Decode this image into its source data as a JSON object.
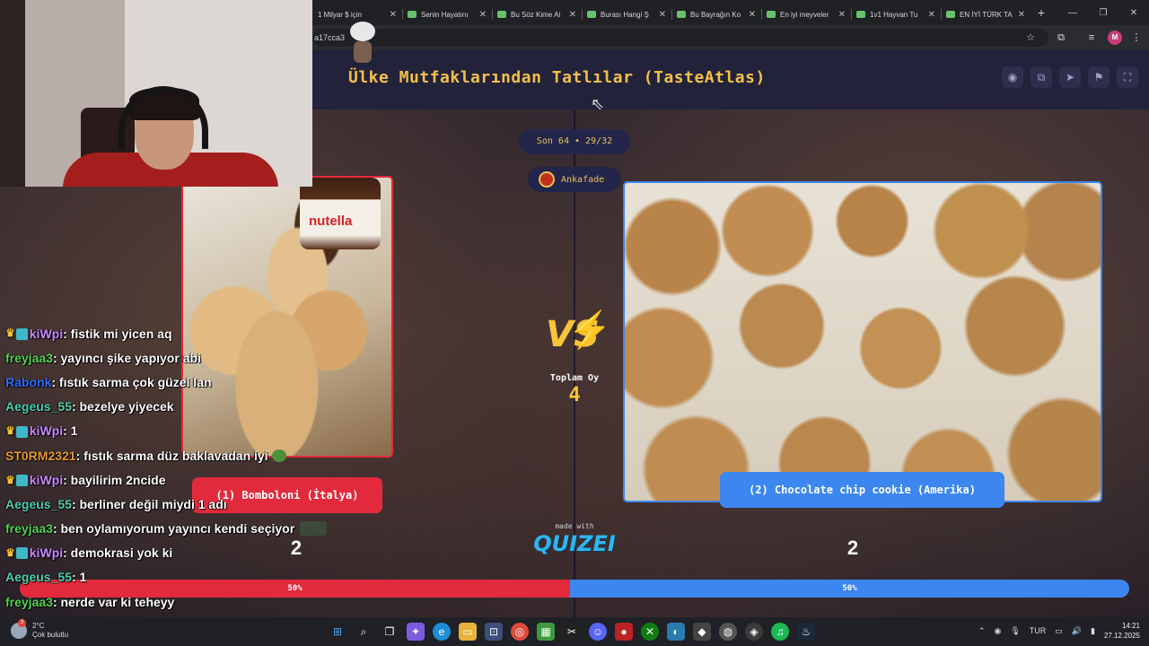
{
  "browser": {
    "tabs": [
      {
        "label": "1 Milyar $ için"
      },
      {
        "label": "Senin Hayatını"
      },
      {
        "label": "Bu Söz Kime Ai"
      },
      {
        "label": "Burası Hangi Ş"
      },
      {
        "label": "Bu Bayrağın Ko"
      },
      {
        "label": "En iyi meyveler"
      },
      {
        "label": "1v1 Hayvan Tu"
      },
      {
        "label": "EN İYİ TÜRK TA"
      }
    ],
    "url_fragment": "a17cca3",
    "profile_initial": "M"
  },
  "quiz": {
    "title": "Ülke Mutfaklarından Tatlılar (TasteAtlas)",
    "round": "Son 64 • 29/32",
    "creator": "Ankafade",
    "total_label": "Toplam Oy",
    "total_votes": "4",
    "left": {
      "name": "(1) Bomboloni (İtalya)",
      "votes": "2",
      "percent": "50%",
      "percent_value": 50,
      "image_text": "nutella"
    },
    "right": {
      "name": "(2) Chocolate chip cookie (Amerika)",
      "votes": "2",
      "percent": "50%",
      "percent_value": 50
    },
    "made_with": "made with",
    "brand": "QUIZEI",
    "vs": "VS"
  },
  "chat": [
    {
      "user": "kiWpi",
      "color": "#c98aff",
      "badges": true,
      "text": "fistik mi yicen aq"
    },
    {
      "user": "freyjaa3",
      "color": "#56d156",
      "badges": false,
      "text": "yayıncı şike yapıyor abi"
    },
    {
      "user": "Rabonk",
      "color": "#2f6dff",
      "badges": false,
      "text": "fıstık sarma çok güzel lan"
    },
    {
      "user": "Aegeus_55",
      "color": "#4fd0b0",
      "badges": false,
      "text": "bezelye yiyecek"
    },
    {
      "user": "kiWpi",
      "color": "#c98aff",
      "badges": true,
      "text": "1"
    },
    {
      "user": "ST0RM2321",
      "color": "#e89a2b",
      "badges": false,
      "text": "fıstık sarma düz baklavadan iyi",
      "pepe": true
    },
    {
      "user": "kiWpi",
      "color": "#c98aff",
      "badges": true,
      "text": "bayilirim 2ncide"
    },
    {
      "user": "Aegeus_55",
      "color": "#4fd0b0",
      "badges": false,
      "text": "berliner değil miydi 1 adı"
    },
    {
      "user": "freyjaa3",
      "color": "#56d156",
      "badges": false,
      "text": "ben oylamıyorum yayıncı kendi seçiyor",
      "emote": true
    },
    {
      "user": "kiWpi",
      "color": "#c98aff",
      "badges": true,
      "text": "demokrasi yok ki"
    },
    {
      "user": "Aegeus_55",
      "color": "#4fd0b0",
      "badges": false,
      "text": "1"
    },
    {
      "user": "freyjaa3",
      "color": "#56d156",
      "badges": false,
      "text": "nerde var ki teheyy"
    }
  ],
  "taskbar": {
    "weather_temp": "2°C",
    "weather_desc": "Çok bulutlu",
    "weather_badge": "3",
    "language": "TUR",
    "time": "14:21",
    "date": "27.12.2025"
  }
}
